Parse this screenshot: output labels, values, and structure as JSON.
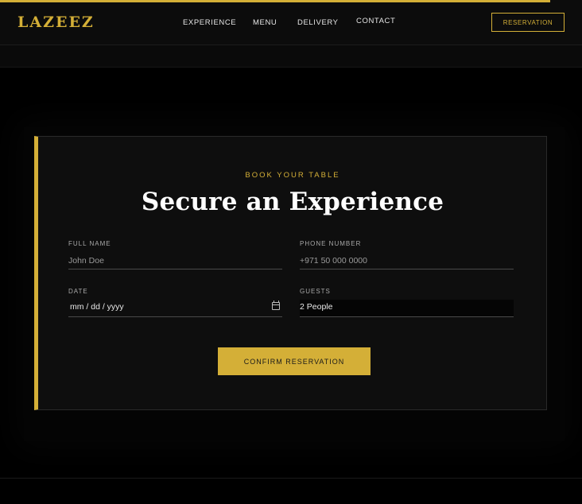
{
  "nav": {
    "logo": "LAZEEZ",
    "links": [
      "EXPERIENCE",
      "MENU",
      "DELIVERY",
      "CONTACT"
    ],
    "reservation_label": "RESERVATION",
    "scroll_progress": 0.945
  },
  "booking": {
    "eyebrow": "BOOK YOUR TABLE",
    "title": "Secure an Experience",
    "fields": {
      "full_name": {
        "label": "FULL NAME",
        "placeholder": "John Doe"
      },
      "phone": {
        "label": "PHONE NUMBER",
        "placeholder": "+971 50 000 0000"
      },
      "date": {
        "label": "DATE",
        "value": "mm / dd / yyyy"
      },
      "guests": {
        "label": "GUESTS",
        "value": "2 People"
      }
    },
    "submit_label": "CONFIRM RESERVATION"
  },
  "colors": {
    "accent": "#d4af37",
    "background": "#000000",
    "card": "#0e0e0e"
  }
}
